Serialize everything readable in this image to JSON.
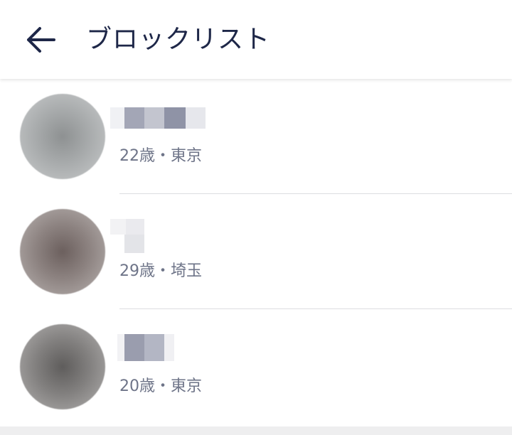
{
  "header": {
    "back_icon": "arrow-left-icon",
    "title": "ブロックリスト"
  },
  "colors": {
    "title": "#1e2748",
    "meta_text": "#6e7488",
    "divider": "#dcdde1"
  },
  "blocked_users": [
    {
      "name": "",
      "age_location": "22歳・東京"
    },
    {
      "name": "",
      "age_location": "29歳・埼玉"
    },
    {
      "name": "",
      "age_location": "20歳・東京"
    }
  ]
}
